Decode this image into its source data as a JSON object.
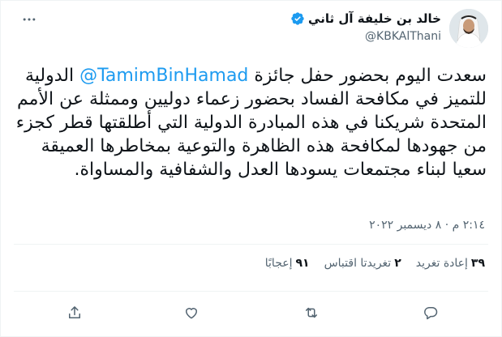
{
  "author": {
    "display_name": "خالد بن خليفة آل ثاني",
    "handle": "@KBKAlThani"
  },
  "tweet": {
    "text_before": "سعدت اليوم بحضور حفل جائزة ",
    "mention": "@TamimBinHamad",
    "text_after": " الدولية للتميز في مكافحة الفساد بحضور زعماء دوليين وممثلة عن الأمم المتحدة شريكنا في هذه المبادرة الدولية التي أطلقتها قطر كجزء من جهودها لمكافحة هذه الظاهرة والتوعية بمخاطرها العميقة سعيا لبناء مجتمعات يسودها العدل والشفافية والمساواة.",
    "timestamp": "٢:١٤ م · ٨ ديسمبر ٢٠٢٢"
  },
  "stats": {
    "retweets_count": "٣٩",
    "retweets_label": "إعادة تغريد",
    "quotes_count": "٢",
    "quotes_label": "تغريدتا اقتباس",
    "likes_count": "٩١",
    "likes_label": "إعجابًا"
  },
  "icons": {
    "more": "more-icon",
    "verified": "verified-badge-icon",
    "reply": "reply-icon",
    "retweet": "retweet-icon",
    "like": "like-icon",
    "share": "share-icon"
  },
  "colors": {
    "link": "#1d9bf0",
    "verified": "#1d9bf0",
    "text": "#0f1419",
    "secondary": "#536471",
    "divider": "#eff3f4"
  }
}
